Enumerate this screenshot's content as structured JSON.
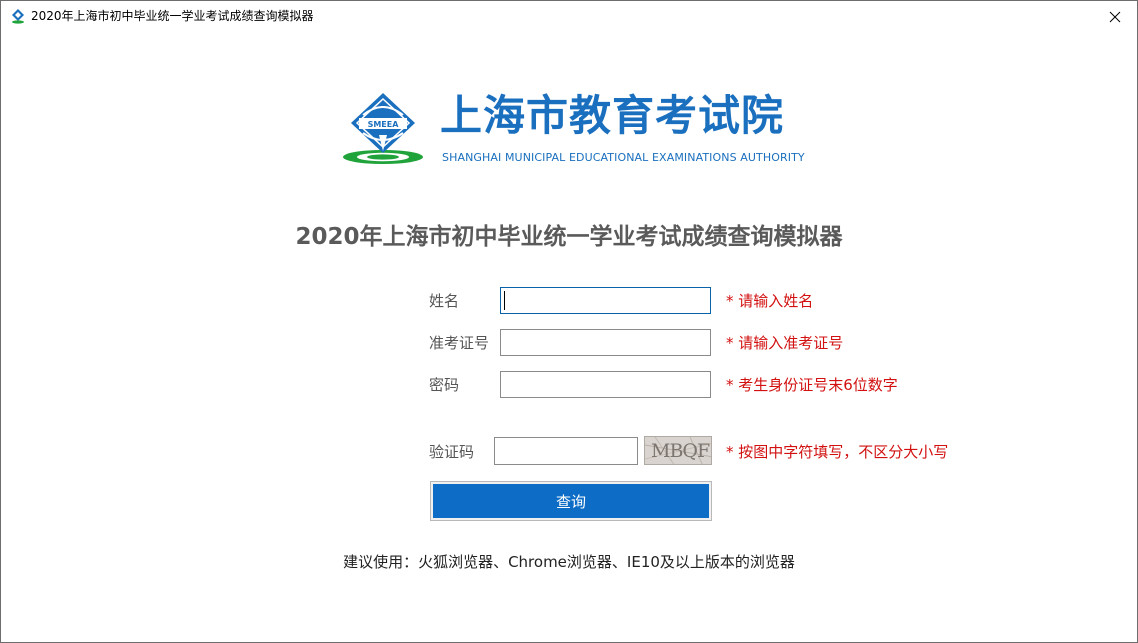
{
  "window": {
    "title": "2020年上海市初中毕业统一学业考试成绩查询模拟器"
  },
  "logo": {
    "name_cn": "上海市教育考试院",
    "name_en": "SHANGHAI MUNICIPAL EDUCATIONAL EXAMINATIONS AUTHORITY",
    "emblem_text": "SMEEA",
    "brand_color": "#1a6fbe",
    "accent_color": "#1fa33a"
  },
  "page": {
    "title": "2020年上海市初中毕业统一学业考试成绩查询模拟器"
  },
  "form": {
    "name": {
      "label": "姓名",
      "value": "",
      "hint": "* 请输入姓名"
    },
    "ticket": {
      "label": "准考证号",
      "value": "",
      "hint": "* 请输入准考证号"
    },
    "password": {
      "label": "密码",
      "value": "",
      "hint": "* 考生身份证号末6位数字"
    },
    "captcha": {
      "label": "验证码",
      "value": "",
      "image_text": "MBQF",
      "hint": "* 按图中字符填写，不区分大小写"
    },
    "submit_label": "查询"
  },
  "footer": {
    "recommend": "建议使用：火狐浏览器、Chrome浏览器、IE10及以上版本的浏览器"
  },
  "colors": {
    "hint": "#d21010",
    "button": "#0d6cc6",
    "title": "#5a5a5a"
  }
}
